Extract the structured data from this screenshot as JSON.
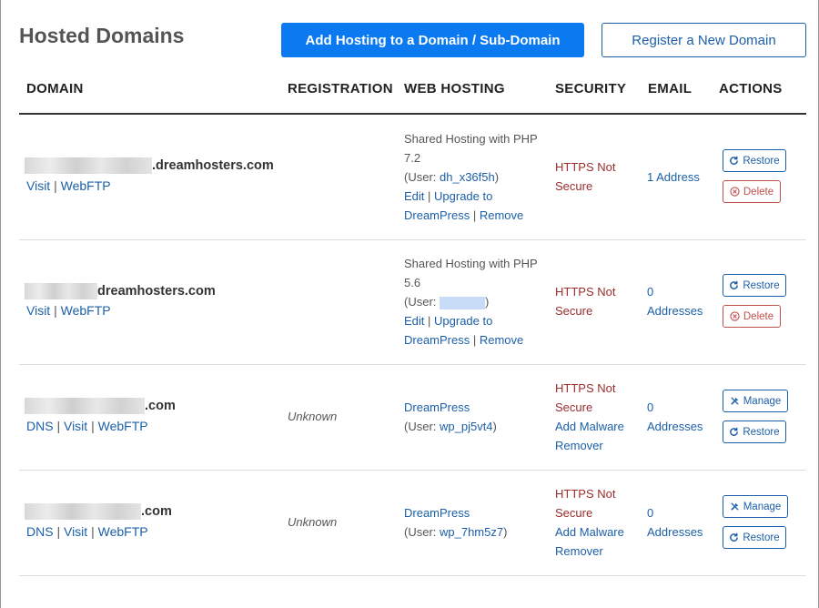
{
  "header": {
    "title": "Hosted Domains",
    "add_hosting_label": "Add Hosting to a Domain / Sub-Domain",
    "register_label": "Register a New Domain"
  },
  "columns": [
    "DOMAIN",
    "REGISTRATION",
    "WEB HOSTING",
    "SECURITY",
    "EMAIL",
    "ACTIONS"
  ],
  "rows": [
    {
      "domain_suffix": ".dreamhosters.com",
      "links": [
        "Visit",
        "WebFTP"
      ],
      "registration": "",
      "hosting": {
        "line1": "Shared Hosting with PHP",
        "line2": "7.2",
        "user_prefix": "(User: ",
        "user": "dh_x36f5h",
        "user_suffix": ")",
        "edit": "Edit",
        "upgrade_a": "Upgrade to",
        "upgrade_b": "DreamPress",
        "remove": "Remove"
      },
      "security": [
        "HTTPS Not",
        "Secure"
      ],
      "email": [
        "1 Address"
      ],
      "actions": [
        "Restore",
        "Delete"
      ]
    },
    {
      "domain_suffix": "dreamhosters.com",
      "links": [
        "Visit",
        "WebFTP"
      ],
      "registration": "",
      "hosting": {
        "line1": "Shared Hosting with PHP",
        "line2": "5.6",
        "user_prefix": "(User: ",
        "user": "",
        "user_suffix": ")",
        "edit": "Edit",
        "upgrade_a": "Upgrade to",
        "upgrade_b": "DreamPress",
        "remove": "Remove"
      },
      "security": [
        "HTTPS Not",
        "Secure"
      ],
      "email": [
        "0",
        "Addresses"
      ],
      "actions": [
        "Restore",
        "Delete"
      ]
    },
    {
      "domain_suffix": ".com",
      "links": [
        "DNS",
        "Visit",
        "WebFTP"
      ],
      "registration": "Unknown",
      "hosting": {
        "line1": "DreamPress",
        "user_prefix": "(User: ",
        "user": "wp_pj5vt4",
        "user_suffix": ")"
      },
      "security": [
        "HTTPS Not",
        "Secure"
      ],
      "security_link": [
        "Add Malware",
        "Remover"
      ],
      "email": [
        "0",
        "Addresses"
      ],
      "actions": [
        "Manage",
        "Restore"
      ]
    },
    {
      "domain_suffix": ".com",
      "links": [
        "DNS",
        "Visit",
        "WebFTP"
      ],
      "registration": "Unknown",
      "hosting": {
        "line1": "DreamPress",
        "user_prefix": "(User: ",
        "user": "wp_7hm5z7",
        "user_suffix": ")"
      },
      "security": [
        "HTTPS Not",
        "Secure"
      ],
      "security_link": [
        "Add Malware",
        "Remover"
      ],
      "email": [
        "0",
        "Addresses"
      ],
      "actions": [
        "Manage",
        "Restore"
      ]
    }
  ],
  "colors": {
    "primary": "#0b7af0",
    "link": "#1c5fa8",
    "danger": "#c0504d",
    "warning_text": "#9b2d2d"
  },
  "icons": {
    "restore": "refresh-icon",
    "delete": "circle-x-icon",
    "manage": "tools-icon"
  }
}
